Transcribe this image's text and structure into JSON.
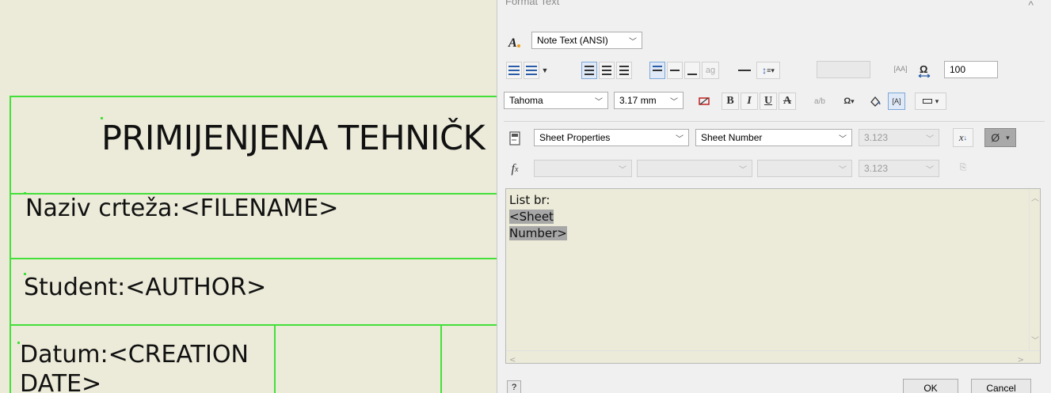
{
  "drawing": {
    "title": "PRIMIJENJENA TEHNIČK",
    "field_drawing_name": "Naziv crteža:<FILENAME>",
    "field_student": "Student:<AUTHOR>",
    "field_date_line1": "Datum:<CREATION",
    "field_date_line2": "DATE>"
  },
  "dialog": {
    "title": "Format Text",
    "close_glyph": "^",
    "style_select": "Note Text (ANSI)",
    "width_scale": "100",
    "font_select": "Tahoma",
    "font_size": "3.17 mm",
    "bold": "B",
    "italic": "I",
    "underline": "U",
    "strike": "A",
    "type_select": "Sheet Properties",
    "property_select": "Sheet Number",
    "precision_select": "3.123",
    "fx_precision": "3.123",
    "diameter_symbol": "Ø",
    "fx_label": "f",
    "fx_sub": "x",
    "editor_line1": "List br:",
    "editor_line2": "<Sheet",
    "editor_line3": "Number>",
    "help": "?",
    "ok": "OK",
    "cancel": "Cancel"
  },
  "colors": {
    "canvas": "#ecead8",
    "frame_lines": "#44e03a",
    "dialog_bg": "#f0f0f0",
    "selection": "#a7a7a7"
  }
}
